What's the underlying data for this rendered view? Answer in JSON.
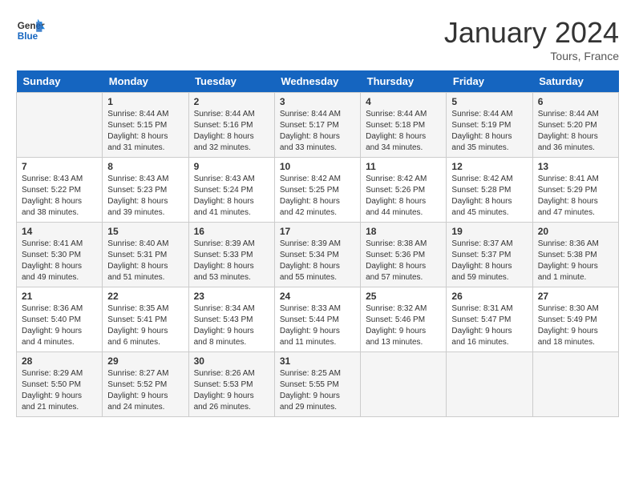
{
  "header": {
    "logo_general": "General",
    "logo_blue": "Blue",
    "month_title": "January 2024",
    "location": "Tours, France"
  },
  "weekdays": [
    "Sunday",
    "Monday",
    "Tuesday",
    "Wednesday",
    "Thursday",
    "Friday",
    "Saturday"
  ],
  "weeks": [
    [
      {
        "day": "",
        "sunrise": "",
        "sunset": "",
        "daylight": ""
      },
      {
        "day": "1",
        "sunrise": "Sunrise: 8:44 AM",
        "sunset": "Sunset: 5:15 PM",
        "daylight": "Daylight: 8 hours and 31 minutes."
      },
      {
        "day": "2",
        "sunrise": "Sunrise: 8:44 AM",
        "sunset": "Sunset: 5:16 PM",
        "daylight": "Daylight: 8 hours and 32 minutes."
      },
      {
        "day": "3",
        "sunrise": "Sunrise: 8:44 AM",
        "sunset": "Sunset: 5:17 PM",
        "daylight": "Daylight: 8 hours and 33 minutes."
      },
      {
        "day": "4",
        "sunrise": "Sunrise: 8:44 AM",
        "sunset": "Sunset: 5:18 PM",
        "daylight": "Daylight: 8 hours and 34 minutes."
      },
      {
        "day": "5",
        "sunrise": "Sunrise: 8:44 AM",
        "sunset": "Sunset: 5:19 PM",
        "daylight": "Daylight: 8 hours and 35 minutes."
      },
      {
        "day": "6",
        "sunrise": "Sunrise: 8:44 AM",
        "sunset": "Sunset: 5:20 PM",
        "daylight": "Daylight: 8 hours and 36 minutes."
      }
    ],
    [
      {
        "day": "7",
        "sunrise": "Sunrise: 8:43 AM",
        "sunset": "Sunset: 5:22 PM",
        "daylight": "Daylight: 8 hours and 38 minutes."
      },
      {
        "day": "8",
        "sunrise": "Sunrise: 8:43 AM",
        "sunset": "Sunset: 5:23 PM",
        "daylight": "Daylight: 8 hours and 39 minutes."
      },
      {
        "day": "9",
        "sunrise": "Sunrise: 8:43 AM",
        "sunset": "Sunset: 5:24 PM",
        "daylight": "Daylight: 8 hours and 41 minutes."
      },
      {
        "day": "10",
        "sunrise": "Sunrise: 8:42 AM",
        "sunset": "Sunset: 5:25 PM",
        "daylight": "Daylight: 8 hours and 42 minutes."
      },
      {
        "day": "11",
        "sunrise": "Sunrise: 8:42 AM",
        "sunset": "Sunset: 5:26 PM",
        "daylight": "Daylight: 8 hours and 44 minutes."
      },
      {
        "day": "12",
        "sunrise": "Sunrise: 8:42 AM",
        "sunset": "Sunset: 5:28 PM",
        "daylight": "Daylight: 8 hours and 45 minutes."
      },
      {
        "day": "13",
        "sunrise": "Sunrise: 8:41 AM",
        "sunset": "Sunset: 5:29 PM",
        "daylight": "Daylight: 8 hours and 47 minutes."
      }
    ],
    [
      {
        "day": "14",
        "sunrise": "Sunrise: 8:41 AM",
        "sunset": "Sunset: 5:30 PM",
        "daylight": "Daylight: 8 hours and 49 minutes."
      },
      {
        "day": "15",
        "sunrise": "Sunrise: 8:40 AM",
        "sunset": "Sunset: 5:31 PM",
        "daylight": "Daylight: 8 hours and 51 minutes."
      },
      {
        "day": "16",
        "sunrise": "Sunrise: 8:39 AM",
        "sunset": "Sunset: 5:33 PM",
        "daylight": "Daylight: 8 hours and 53 minutes."
      },
      {
        "day": "17",
        "sunrise": "Sunrise: 8:39 AM",
        "sunset": "Sunset: 5:34 PM",
        "daylight": "Daylight: 8 hours and 55 minutes."
      },
      {
        "day": "18",
        "sunrise": "Sunrise: 8:38 AM",
        "sunset": "Sunset: 5:36 PM",
        "daylight": "Daylight: 8 hours and 57 minutes."
      },
      {
        "day": "19",
        "sunrise": "Sunrise: 8:37 AM",
        "sunset": "Sunset: 5:37 PM",
        "daylight": "Daylight: 8 hours and 59 minutes."
      },
      {
        "day": "20",
        "sunrise": "Sunrise: 8:36 AM",
        "sunset": "Sunset: 5:38 PM",
        "daylight": "Daylight: 9 hours and 1 minute."
      }
    ],
    [
      {
        "day": "21",
        "sunrise": "Sunrise: 8:36 AM",
        "sunset": "Sunset: 5:40 PM",
        "daylight": "Daylight: 9 hours and 4 minutes."
      },
      {
        "day": "22",
        "sunrise": "Sunrise: 8:35 AM",
        "sunset": "Sunset: 5:41 PM",
        "daylight": "Daylight: 9 hours and 6 minutes."
      },
      {
        "day": "23",
        "sunrise": "Sunrise: 8:34 AM",
        "sunset": "Sunset: 5:43 PM",
        "daylight": "Daylight: 9 hours and 8 minutes."
      },
      {
        "day": "24",
        "sunrise": "Sunrise: 8:33 AM",
        "sunset": "Sunset: 5:44 PM",
        "daylight": "Daylight: 9 hours and 11 minutes."
      },
      {
        "day": "25",
        "sunrise": "Sunrise: 8:32 AM",
        "sunset": "Sunset: 5:46 PM",
        "daylight": "Daylight: 9 hours and 13 minutes."
      },
      {
        "day": "26",
        "sunrise": "Sunrise: 8:31 AM",
        "sunset": "Sunset: 5:47 PM",
        "daylight": "Daylight: 9 hours and 16 minutes."
      },
      {
        "day": "27",
        "sunrise": "Sunrise: 8:30 AM",
        "sunset": "Sunset: 5:49 PM",
        "daylight": "Daylight: 9 hours and 18 minutes."
      }
    ],
    [
      {
        "day": "28",
        "sunrise": "Sunrise: 8:29 AM",
        "sunset": "Sunset: 5:50 PM",
        "daylight": "Daylight: 9 hours and 21 minutes."
      },
      {
        "day": "29",
        "sunrise": "Sunrise: 8:27 AM",
        "sunset": "Sunset: 5:52 PM",
        "daylight": "Daylight: 9 hours and 24 minutes."
      },
      {
        "day": "30",
        "sunrise": "Sunrise: 8:26 AM",
        "sunset": "Sunset: 5:53 PM",
        "daylight": "Daylight: 9 hours and 26 minutes."
      },
      {
        "day": "31",
        "sunrise": "Sunrise: 8:25 AM",
        "sunset": "Sunset: 5:55 PM",
        "daylight": "Daylight: 9 hours and 29 minutes."
      },
      {
        "day": "",
        "sunrise": "",
        "sunset": "",
        "daylight": ""
      },
      {
        "day": "",
        "sunrise": "",
        "sunset": "",
        "daylight": ""
      },
      {
        "day": "",
        "sunrise": "",
        "sunset": "",
        "daylight": ""
      }
    ]
  ]
}
